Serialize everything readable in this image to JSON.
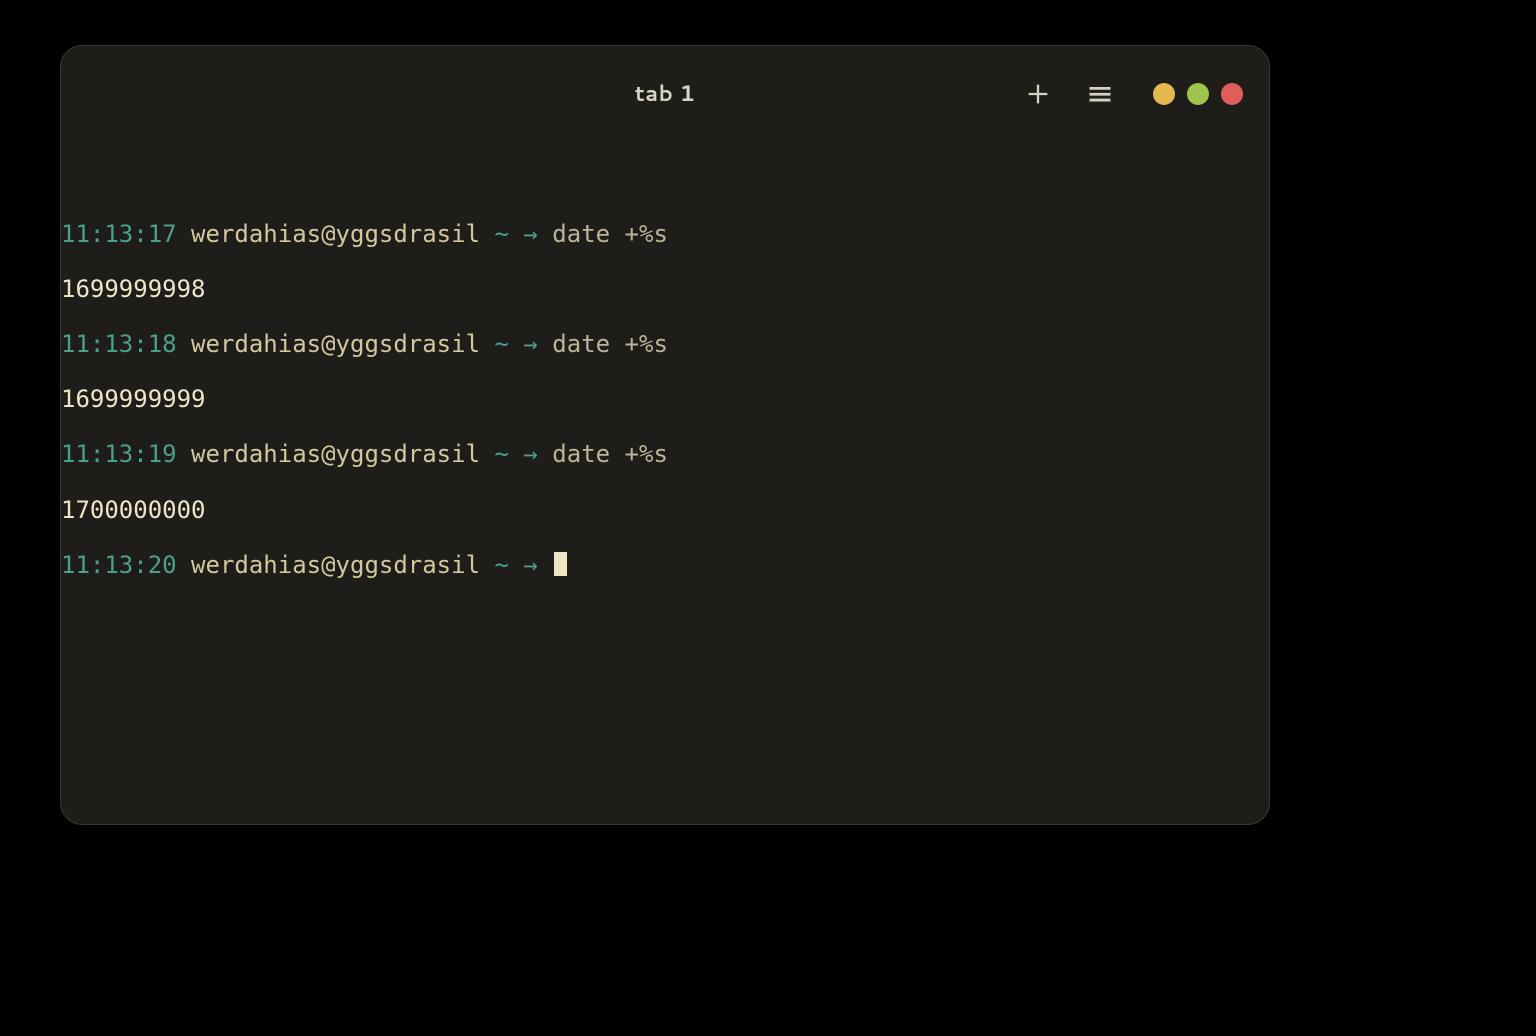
{
  "header": {
    "title": "tab 1",
    "icons": {
      "new_tab": "plus-icon",
      "menu": "hamburger-icon",
      "minimize": "minimize-dot",
      "maximize": "maximize-dot",
      "close": "close-dot"
    }
  },
  "colors": {
    "bg": "#000000",
    "window_bg": "#1e1d1a",
    "text_primary": "#d9d4c6",
    "clock": "#4aa08b",
    "user": "#d3c79e",
    "arrow": "#4aa08b",
    "command": "#bdb498",
    "output": "#efe4c6",
    "dot_minimize": "#e5b94e",
    "dot_maximize": "#9fc34d",
    "dot_close": "#df5e59"
  },
  "prompt": {
    "user": "werdahias",
    "host": "yggsdrasil",
    "dir_symbol": "~",
    "arrow": "→"
  },
  "blocks": [
    {
      "time": "11:13:17",
      "command": "date +%s",
      "output": "1699999998"
    },
    {
      "time": "11:13:18",
      "command": "date +%s",
      "output": "1699999999"
    },
    {
      "time": "11:13:19",
      "command": "date +%s",
      "output": "1700000000"
    }
  ],
  "active_prompt": {
    "time": "11:13:20",
    "command": ""
  },
  "userhost": "werdahias@yggsdrasil",
  "b0_time": "11:13:17",
  "b0_cmd": "date +%s",
  "b0_out": "1699999998",
  "b1_time": "11:13:18",
  "b1_cmd": "date +%s",
  "b1_out": "1699999999",
  "b2_time": "11:13:19",
  "b2_cmd": "date +%s",
  "b2_out": "1700000000",
  "b3_time": "11:13:20"
}
